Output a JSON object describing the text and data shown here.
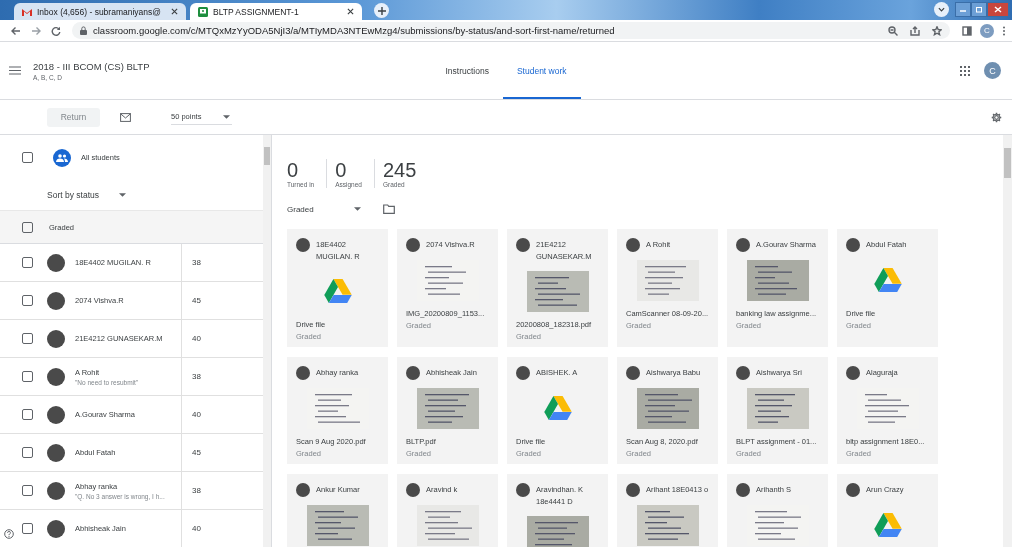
{
  "browser": {
    "tabs": [
      {
        "title": "Inbox (4,656) - subramaniyans@",
        "kind": "mail",
        "selected": false
      },
      {
        "title": "BLTP ASSIGNMENT-1",
        "kind": "classroom",
        "selected": true
      }
    ],
    "url": "classroom.google.com/c/MTQxMzYyODA5NjI3/a/MTIyMDA3NTEwMzg4/submissions/by-status/and-sort-first-name/returned",
    "profile_initial": "C"
  },
  "header": {
    "title": "2018 - III BCOM (CS) BLTP",
    "sections": "A, B, C, D",
    "tabs": [
      {
        "label": "Instructions",
        "selected": false
      },
      {
        "label": "Student work",
        "selected": true
      }
    ],
    "account_initial": "C"
  },
  "toolbar": {
    "return_button": {
      "label": "Return",
      "disabled": true
    },
    "points": "50 points"
  },
  "students": {
    "all_label": "All students",
    "all_checked": false,
    "sort": "Sort by status",
    "group": {
      "label": "Graded",
      "checked": false
    },
    "rows": [
      {
        "name": "18E4402 MUGILAN. R",
        "score": "38",
        "checked": false
      },
      {
        "name": "2074 Vishva.R",
        "score": "45",
        "checked": false
      },
      {
        "name": "21E4212 GUNASEKAR.M",
        "score": "40",
        "checked": false
      },
      {
        "name": "A Rohit",
        "comment": "\"No need to resubmit\"",
        "score": "38",
        "checked": false
      },
      {
        "name": "A.Gourav Sharma",
        "score": "40",
        "checked": false
      },
      {
        "name": "Abdul Fatah",
        "score": "45",
        "checked": false
      },
      {
        "name": "Abhay ranka",
        "comment": "\"Q. No 3 answer is wrong, I h...",
        "score": "38",
        "checked": false
      },
      {
        "name": "Abhisheak Jain",
        "score": "40",
        "checked": false
      }
    ]
  },
  "work": {
    "stats": [
      {
        "value": "0",
        "label": "Turned in"
      },
      {
        "value": "0",
        "label": "Assigned"
      },
      {
        "value": "245",
        "label": "Graded"
      }
    ],
    "filter": "Graded",
    "cards": [
      {
        "name": "18E4402 MUGILAN. R",
        "kind": "drive",
        "file": "Drive file",
        "status": "Graded"
      },
      {
        "name": "2074 Vishva.R",
        "kind": "picture",
        "file": "IMG_20200809_1153...",
        "status": "Graded"
      },
      {
        "name": "21E4212 GUNASEKAR.M",
        "kind": "picture",
        "file": "20200808_182318.pdf",
        "status": "Graded"
      },
      {
        "name": "A Rohit",
        "kind": "picture",
        "file": "CamScanner 08-09-20...",
        "status": "Graded"
      },
      {
        "name": "A.Gourav Sharma",
        "kind": "picture",
        "file": "banking law assignme...",
        "status": "Graded"
      },
      {
        "name": "Abdul Fatah",
        "kind": "drive",
        "file": "Drive file",
        "status": "Graded"
      },
      {
        "name": "Abhay ranka",
        "kind": "picture",
        "file": "Scan 9 Aug 2020.pdf",
        "status": "Graded"
      },
      {
        "name": "Abhisheak Jain",
        "kind": "picture",
        "file": "BLTP.pdf",
        "status": "Graded"
      },
      {
        "name": "ABISHEK. A",
        "kind": "drive",
        "file": "Drive file",
        "status": "Graded"
      },
      {
        "name": "Aishwarya Babu",
        "kind": "picture",
        "file": "Scan Aug 8, 2020.pdf",
        "status": "Graded"
      },
      {
        "name": "Aishwarya Sri",
        "kind": "picture",
        "file": "BLPT assignment - 01...",
        "status": "Graded"
      },
      {
        "name": "Alaguraja",
        "kind": "picture",
        "file": "bltp assignment 18E0...",
        "status": "Graded"
      },
      {
        "name": "Ankur Kumar",
        "kind": "picture"
      },
      {
        "name": "Aravind k",
        "kind": "picture"
      },
      {
        "name": "Aravindhan. K 18e4441 D",
        "kind": "picture"
      },
      {
        "name": "Arihant 18E0413 o",
        "kind": "picture"
      },
      {
        "name": "Arihanth S",
        "kind": "picture"
      },
      {
        "name": "Arun Crazy",
        "kind": "drive"
      }
    ]
  }
}
